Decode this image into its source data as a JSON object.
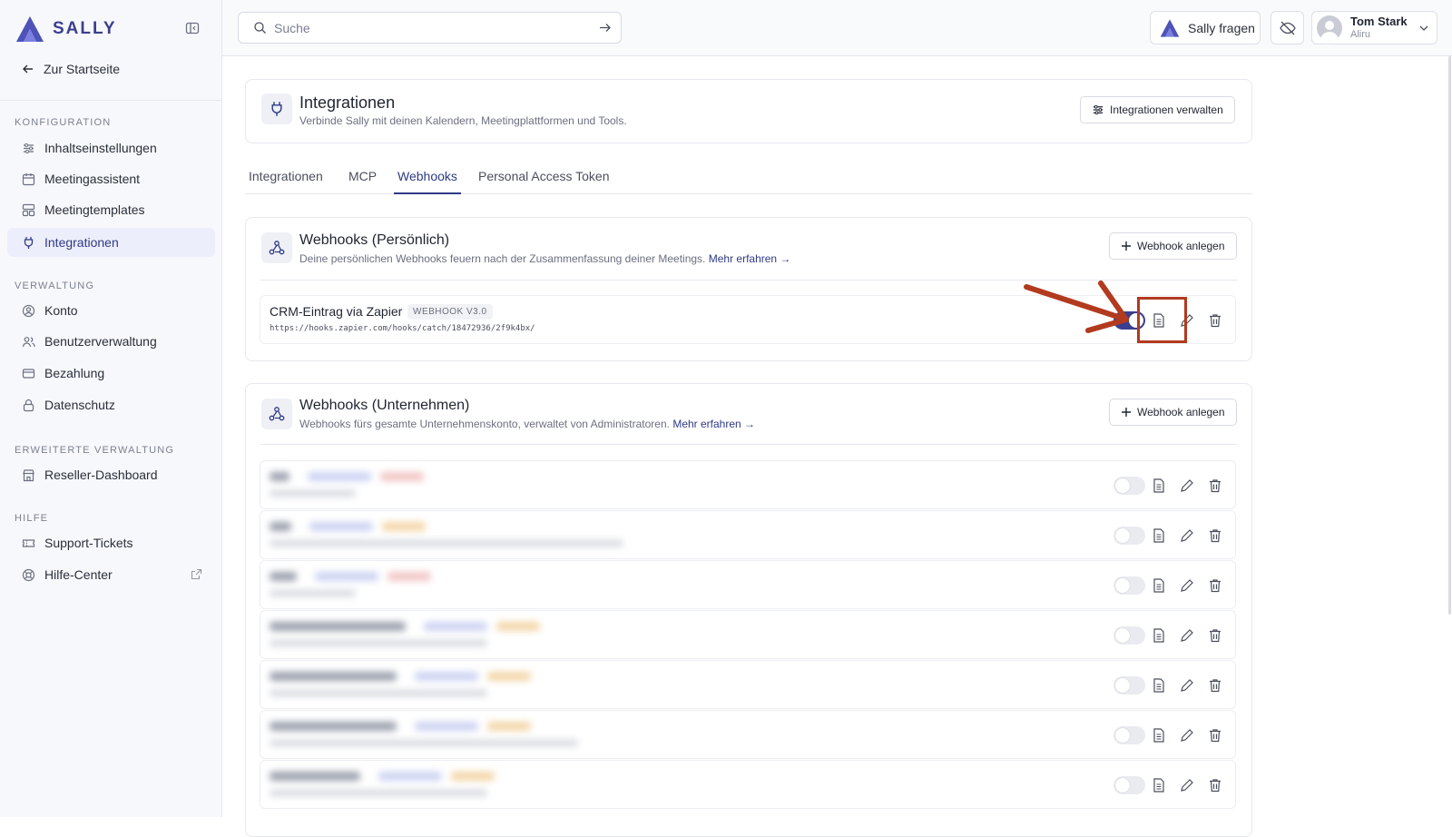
{
  "sidebar": {
    "logo_text": "SALLY",
    "home": "Zur Startseite",
    "sections": [
      {
        "title": "KONFIGURATION",
        "items": [
          "Inhaltseinstellungen",
          "Meetingassistent",
          "Meetingtemplates",
          "Integrationen"
        ]
      },
      {
        "title": "VERWALTUNG",
        "items": [
          "Konto",
          "Benutzerverwaltung",
          "Bezahlung",
          "Datenschutz"
        ]
      },
      {
        "title": "ERWEITERTE VERWALTUNG",
        "items": [
          "Reseller-Dashboard"
        ]
      },
      {
        "title": "HILFE",
        "items": [
          "Support-Tickets",
          "Hilfe-Center"
        ]
      }
    ],
    "active_item": "Integrationen"
  },
  "topbar": {
    "search_placeholder": "Suche",
    "ask_label": "Sally fragen",
    "user_name": "Tom Stark",
    "user_org": "Aliru"
  },
  "header": {
    "title": "Integrationen",
    "subtitle": "Verbinde Sally mit deinen Kalendern, Meetingplattformen und Tools.",
    "manage_button": "Integrationen verwalten"
  },
  "tabs": [
    "Integrationen",
    "MCP",
    "Webhooks",
    "Personal Access Token"
  ],
  "active_tab": "Webhooks",
  "personal": {
    "title": "Webhooks (Persönlich)",
    "subtitle": "Deine persönlichen Webhooks feuern nach der Zusammenfassung deiner Meetings.",
    "link": "Mehr erfahren →",
    "add_button": "Webhook anlegen",
    "webhook": {
      "name": "CRM-Eintrag via Zapier",
      "badge": "WEBHOOK V3.0",
      "url": "https://hooks.zapier.com/hooks/catch/18472936/2f9k4bx/",
      "enabled": true
    }
  },
  "company": {
    "title": "Webhooks (Unternehmen)",
    "subtitle": "Webhooks fürs gesamte Unternehmenskonto, verwaltet von Administratoren.",
    "link": "Mehr erfahren →",
    "add_button": "Webhook anlegen",
    "row_count_visible": 7,
    "rows_enabled": [
      false,
      false,
      false,
      false,
      false,
      false,
      false
    ]
  },
  "colors": {
    "accent": "#2f3a86",
    "annotation": "#b23a1e"
  }
}
